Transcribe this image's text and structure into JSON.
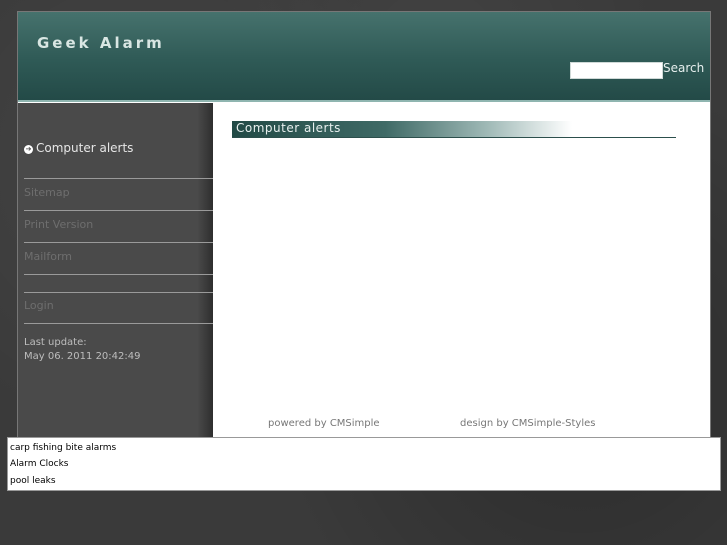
{
  "site": {
    "title": "Geek Alarm"
  },
  "search": {
    "button_label": "Search",
    "value": "",
    "placeholder": ""
  },
  "nav": {
    "current": "Computer alerts",
    "links": [
      "Sitemap",
      "Print Version",
      "Mailform",
      "Login"
    ]
  },
  "last_update": {
    "label": "Last update:",
    "value": "May 06. 2011 20:42:49"
  },
  "content": {
    "heading": "Computer alerts"
  },
  "footer": {
    "powered_prefix": "powered by ",
    "powered_link": "CMSimple",
    "design_prefix": "design by ",
    "design_link": "CMSimple-Styles"
  },
  "bottom_links": [
    "carp fishing bite alarms",
    "Alarm Clocks",
    "pool leaks"
  ]
}
